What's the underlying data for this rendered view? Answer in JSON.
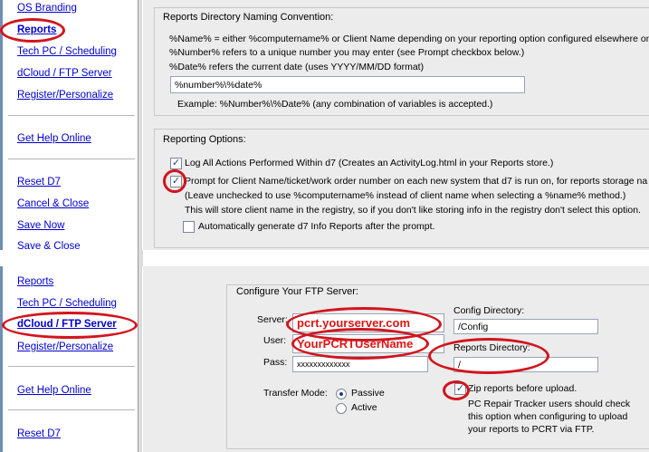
{
  "colors": {
    "link": "#0000cc",
    "annotation": "#d2141e",
    "content_bg": "#ececec",
    "sidebar_accent": "#6f8fb5",
    "value_red": "#dd1414"
  },
  "top": {
    "sidebar": {
      "items": [
        "OS Branding",
        "Reports",
        "Tech PC / Scheduling",
        "dCloud / FTP Server",
        "Register/Personalize",
        "Get Help Online",
        "Reset D7",
        "Cancel & Close",
        "Save Now",
        "Save & Close"
      ]
    },
    "naming": {
      "title": "Reports Directory Naming Convention:",
      "line1": "%Name% = either %computername% or Client Name depending on your reporting option configured elsewhere on",
      "line2": "%Number% refers to a unique number you may enter (see Prompt checkbox below.)",
      "line3": "%Date% refers the current date (uses YYYY/MM/DD format)",
      "input_value": "%number%\\%date%",
      "example": "Example:  %Number%\\%Date%  (any combination of variables is accepted.)"
    },
    "options": {
      "title": "Reporting Options:",
      "cb1_label": "Log All Actions Performed Within d7  (Creates an ActivityLog.html in your Reports store.)",
      "cb2_line1": "Prompt for Client Name/ticket/work order number on each new system that d7 is run on, for reports storage na",
      "cb2_line2": "(Leave unchecked to use %computername% instead of client name when selecting a %name% method.)",
      "cb2_line3": "This will store client name in the registry, so if you don't like storing info in the registry don't select this option.",
      "cb3_label": "Automatically generate d7 Info Reports after the prompt.",
      "check_mark": "✓"
    }
  },
  "bottom": {
    "sidebar": {
      "items": [
        "Reports",
        "Tech PC / Scheduling",
        "dCloud / FTP Server",
        "Register/Personalize",
        "Get Help Online",
        "Reset D7"
      ]
    },
    "ftp": {
      "title": "Configure Your FTP Server:",
      "server_label": "Server:",
      "server_value": "pcrt.yourserver.com",
      "user_label": "User:",
      "user_value": "YourPCRTUserName",
      "pass_label": "Pass:",
      "pass_value": "xxxxxxxxxxxxx",
      "config_label": "Config Directory:",
      "config_value": "/Config",
      "reports_label": "Reports Directory:",
      "reports_value": "/",
      "transfer_label": "Transfer Mode:",
      "passive_label": "Passive",
      "active_label": "Active",
      "zip_label": "Zip reports before upload.",
      "zip_note1": "PC Repair Tracker users should check",
      "zip_note2": "this option when configuring to upload",
      "zip_note3": "your reports to PCRT via FTP.",
      "check_mark": "✓"
    }
  }
}
